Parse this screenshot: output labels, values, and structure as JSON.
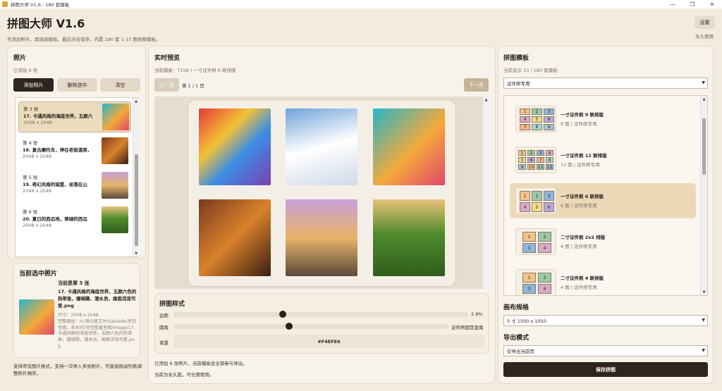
{
  "window": {
    "title": "拼图大师 V1.6 - 180 套模板",
    "min": "—",
    "max": "❐",
    "close": "✕"
  },
  "header": {
    "title": "拼图大师 V1.6",
    "subtitle": "先添加照片，再选择模板，最后点击保存。内置 180 套 1-15 图拼图模板。",
    "settings": "设置",
    "license": "永久使用"
  },
  "photos": {
    "title": "照片",
    "count": "已添加 6 张",
    "add": "添加照片",
    "remove": "删除选中",
    "clear": "清空",
    "items": [
      {
        "index": "第 3 张",
        "name": "17. 卡通风格的海底世界，五颜六",
        "size": "2048 x 2048"
      },
      {
        "index": "第 4 张",
        "name": "18. 复古摩托车，停在老街道旁，",
        "size": "2048 x 2048"
      },
      {
        "index": "第 5 张",
        "name": "19. 奇幻风格的城堡，坐落在山",
        "size": "2048 x 2048"
      },
      {
        "index": "第 6 张",
        "name": "20. 夏日的西瓜地，翠绿的西瓜",
        "size": "2048 x 2048"
      }
    ]
  },
  "selected": {
    "title": "当前选中照片",
    "current": "当前是第 3 张",
    "name": "17. 卡通风格的海底世界，五颜六色的热带鱼，珊瑚礁，潜水员，画面活泼可爱.png",
    "size": "尺寸：2048 x 2048",
    "path": "完整路径：H:/新D盘文件/zijixiede/豆包生图，去水印/豆包批量生图/image/17. 卡通风格的海底世界，五颜六色的热带鱼，珊瑚礁，潜水员，画面活泼可爱.png"
  },
  "tip": "支持常见图片格式，支持一次导入多张照片，可直接拖动列表调整照片顺序。",
  "preview": {
    "title": "实时预览",
    "template_info": "当前模板：T158 | 一寸证件照 6 联排版",
    "prev": "上一页",
    "page": "第 1 / 1 页",
    "next": "下一页"
  },
  "style": {
    "title": "拼图样式",
    "margin_label": "边距",
    "margin_value": "2.9%",
    "margin_ratio": 0.37,
    "radius_label": "圆角",
    "radius_value": "证件照固定直角",
    "radius_ratio": 0.42,
    "bg_label": "背景",
    "bg_value": "#F4EFE6"
  },
  "status": {
    "line1": "已添加 6 张照片，当前模板会全部参与导出。",
    "line2": "当前为永久版，可长期使用。"
  },
  "templates": {
    "title": "拼图模板",
    "count": "当前显示 13 / 180 套模板",
    "filter": "证件照专用",
    "items": [
      {
        "name": "一寸证件照 9 联排版",
        "desc": "9 图 | 证件照专用"
      },
      {
        "name": "一寸证件照 12 联排版",
        "desc": "12 图 | 证件照专用"
      },
      {
        "name": "一寸证件照 6 联排版",
        "desc": "6 图 | 证件照专用"
      },
      {
        "name": "二寸证件照 2x2 排版",
        "desc": "4 图 | 证件照专用"
      },
      {
        "name": "二寸证件照 4 联排版",
        "desc": "4 图 | 证件照专用"
      }
    ]
  },
  "canvas": {
    "title": "画布规格",
    "value": "5 寸 1500 x 1050"
  },
  "export": {
    "title": "导出模式",
    "value": "仅导出当前页",
    "save": "保存拼图"
  },
  "colors": {
    "accent": "#2f251d",
    "selected": "#ecdcbd",
    "background": "#F4EFE6"
  }
}
